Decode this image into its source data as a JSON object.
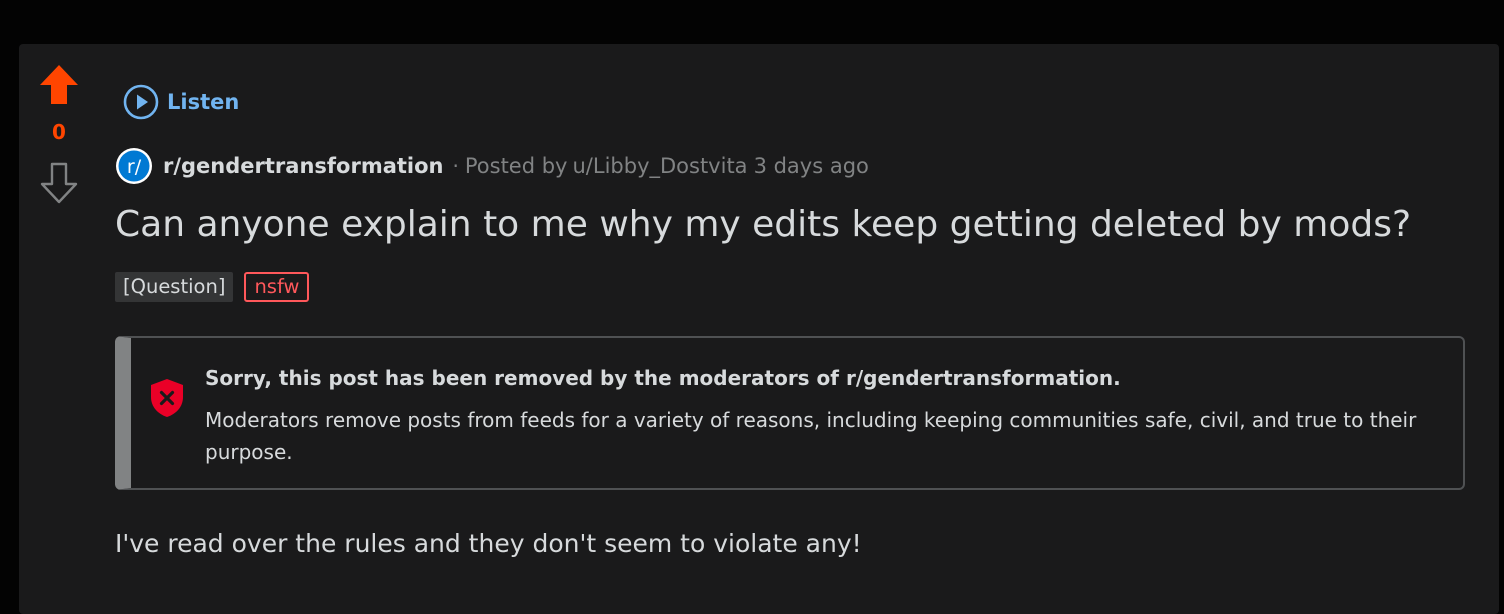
{
  "vote": {
    "score": "0",
    "upvote_icon": "upvote-arrow-icon",
    "downvote_icon": "downvote-arrow-icon"
  },
  "listen": {
    "label": "Listen",
    "icon": "play-circle-icon"
  },
  "post": {
    "subreddit": "r/gendertransformation",
    "subreddit_icon_text": "r/",
    "separator": "·",
    "posted_by_label": "Posted by",
    "author": "u/Libby_Dostvita",
    "time": "3 days ago",
    "title": "Can anyone explain to me why my edits keep getting deleted by mods?",
    "flair": "[Question]",
    "nsfw_tag": "nsfw",
    "body": "I've read over the rules and they don't seem to violate any!"
  },
  "removed_notice": {
    "icon": "shield-x-icon",
    "heading": "Sorry, this post has been removed by the moderators of r/gendertransformation.",
    "body": "Moderators remove posts from feeds for a variety of reasons, including keeping communities safe, civil, and true to their purpose."
  },
  "colors": {
    "page_bg": "#030303",
    "card_bg": "#1a1a1b",
    "upvote": "#ff4500",
    "link": "#71b4f0",
    "text": "#d7dadc",
    "muted": "#818384",
    "nsfw": "#ff585b",
    "shield": "#ea0027"
  }
}
